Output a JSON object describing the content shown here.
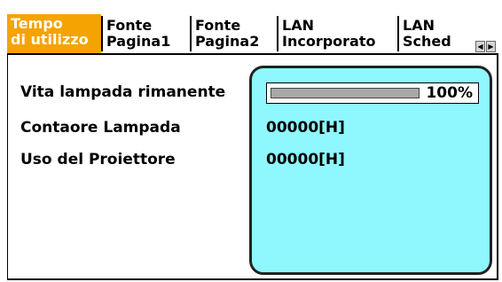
{
  "tabs": [
    {
      "line1": "Tempo",
      "line2": "di utilizzo",
      "active": true
    },
    {
      "line1": "Fonte",
      "line2": "Pagina1",
      "active": false
    },
    {
      "line1": "Fonte",
      "line2": "Pagina2",
      "active": false
    },
    {
      "line1": "LAN",
      "line2": "Incorporato",
      "active": false
    },
    {
      "line1": "LAN",
      "line2": "Sched",
      "active": false
    }
  ],
  "scroll": {
    "left_icon": "arrow-left-icon",
    "right_icon": "arrow-right-icon"
  },
  "rows": {
    "lamp_life": {
      "label": "Vita lampada rimanente",
      "percent_text": "100%",
      "fraction": 1.0
    },
    "lamp_hours": {
      "label": "Contaore Lampada",
      "value": "00000[H]"
    },
    "projector_hours": {
      "label": "Uso del Proiettore",
      "value": "00000[H]"
    }
  },
  "colors": {
    "active_tab": "#f5a300",
    "value_panel": "#8ff8ff"
  }
}
